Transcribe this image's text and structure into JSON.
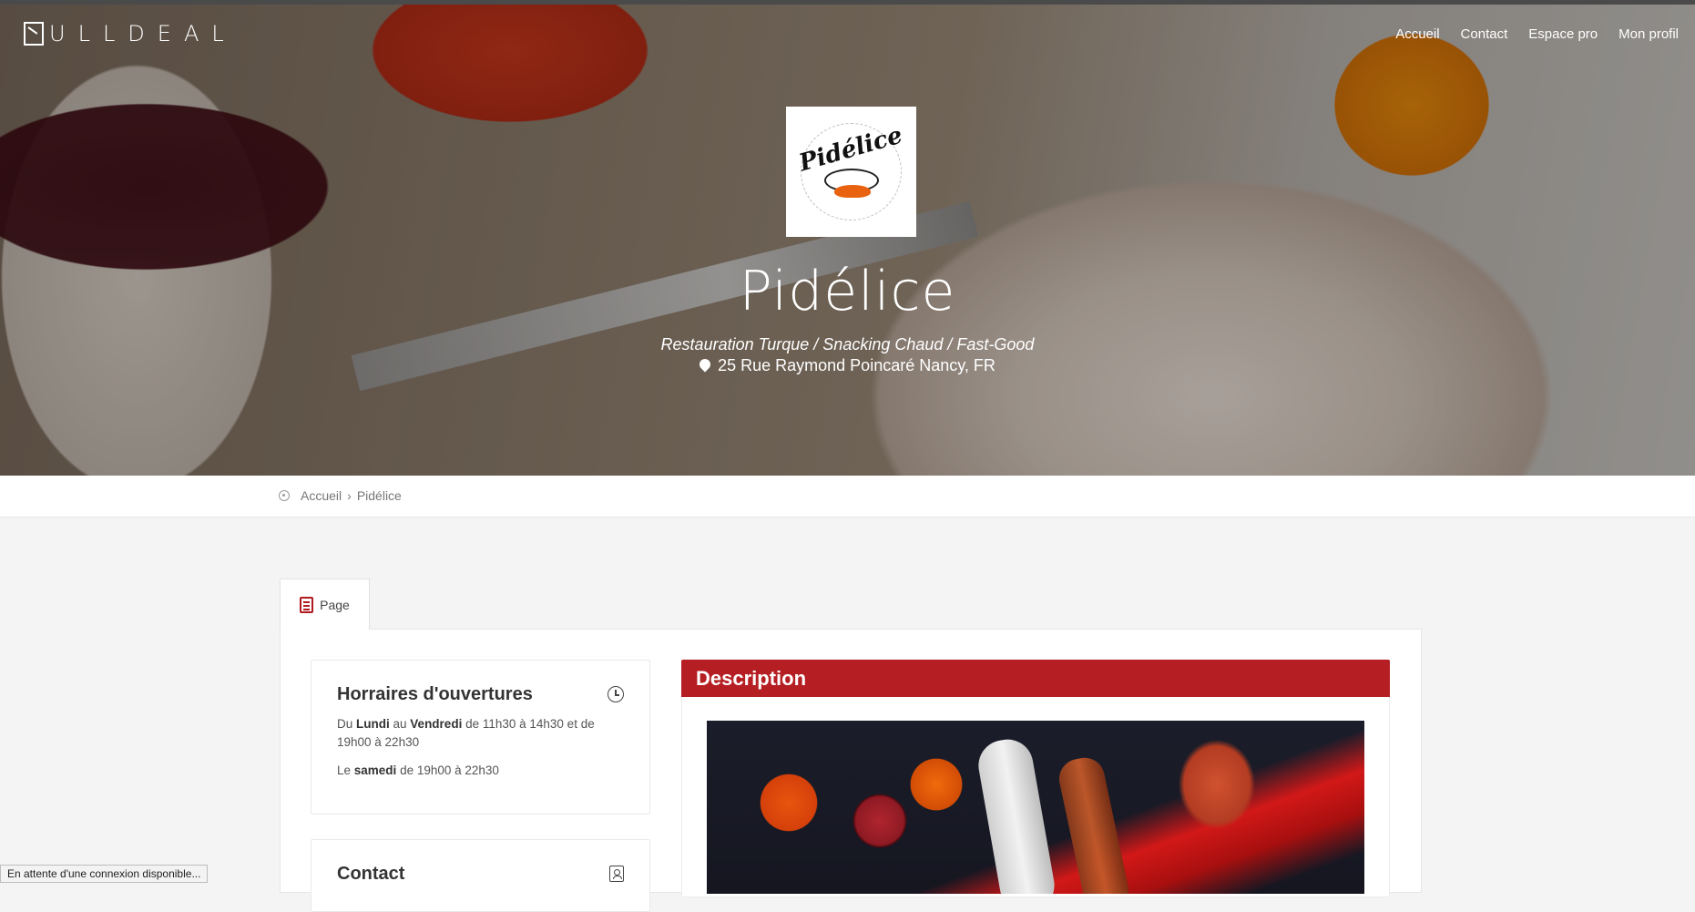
{
  "brand": {
    "name": "ULLDEAL"
  },
  "nav": {
    "items": [
      {
        "label": "Accueil"
      },
      {
        "label": "Contact"
      },
      {
        "label": "Espace pro"
      },
      {
        "label": "Mon profil"
      }
    ]
  },
  "hero": {
    "logo_text": "Pidélice",
    "title": "Pidélice",
    "subtitle": "Restauration Turque / Snacking Chaud / Fast-Good",
    "address": "25 Rue Raymond Poincaré Nancy, FR"
  },
  "breadcrumb": {
    "home": "Accueil",
    "separator": "›",
    "current": "Pidélice"
  },
  "tabs": [
    {
      "label": "Page",
      "icon": "page-icon"
    }
  ],
  "hours": {
    "title": "Horraires d'ouvertures",
    "icon": "clock-icon",
    "line1": {
      "t1": "Du ",
      "b1": "Lundi",
      "t2": " au ",
      "b2": "Vendredi",
      "t3": " de 11h30 à 14h30 et de 19h00 à 22h30"
    },
    "line2": {
      "t1": "Le ",
      "b1": "samedi",
      "t2": " de 19h00 à 22h30"
    }
  },
  "contact": {
    "title": "Contact",
    "icon": "contact-book-icon"
  },
  "description": {
    "title": "Description"
  },
  "statusbar": {
    "text": "En attente d'une connexion disponible..."
  },
  "colors": {
    "accent": "#b51e22",
    "background": "#f4f4f4"
  }
}
